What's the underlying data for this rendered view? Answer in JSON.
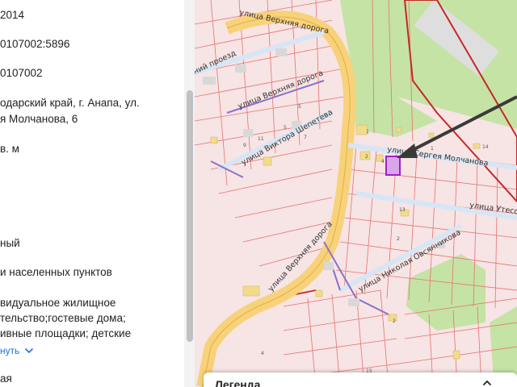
{
  "info": {
    "line1": "2014",
    "line2": "0107002:5896",
    "line3": "0107002",
    "line4": "одарский край, г. Анапа, ул.",
    "line5": "я Молчанова, 6",
    "line6": "в. м",
    "line7": "ный",
    "line8": "и населенных пунктов",
    "line9": "видуальное жилищное",
    "line10": "тельство;гостевые дома;",
    "line11": "ивные площадки; детские",
    "expand_label": "нуть",
    "line12": "ая"
  },
  "map": {
    "streets": {
      "verkhnyaya_top": "улица Верхняя дорога",
      "verkhnyaya_mid": "улица Верхняя дорога",
      "verkhnyaya_bottom": "улица Верхняя дорога",
      "shepeteva": "улица Виктора Шепетева",
      "proezd": "ний проезд",
      "molchanova": "улица Сергея Молчанова",
      "utesova": "улица Утесов",
      "ovsyannikova": "улица Николая Овсянникова"
    },
    "parcel_numbers": [
      "5",
      "5",
      "7",
      "11",
      "9",
      "1",
      "2",
      "4",
      "14",
      "1",
      "13",
      "2",
      "4",
      "2",
      "15"
    ]
  },
  "legend": {
    "title": "Легенда"
  },
  "colors": {
    "parcel_border": "#e57373",
    "road_fill": "#f8d27a",
    "green_zone": "#c5e3a5",
    "selection": "#a020c8",
    "arrow": "#3a3a3a",
    "link": "#1a73e8"
  }
}
